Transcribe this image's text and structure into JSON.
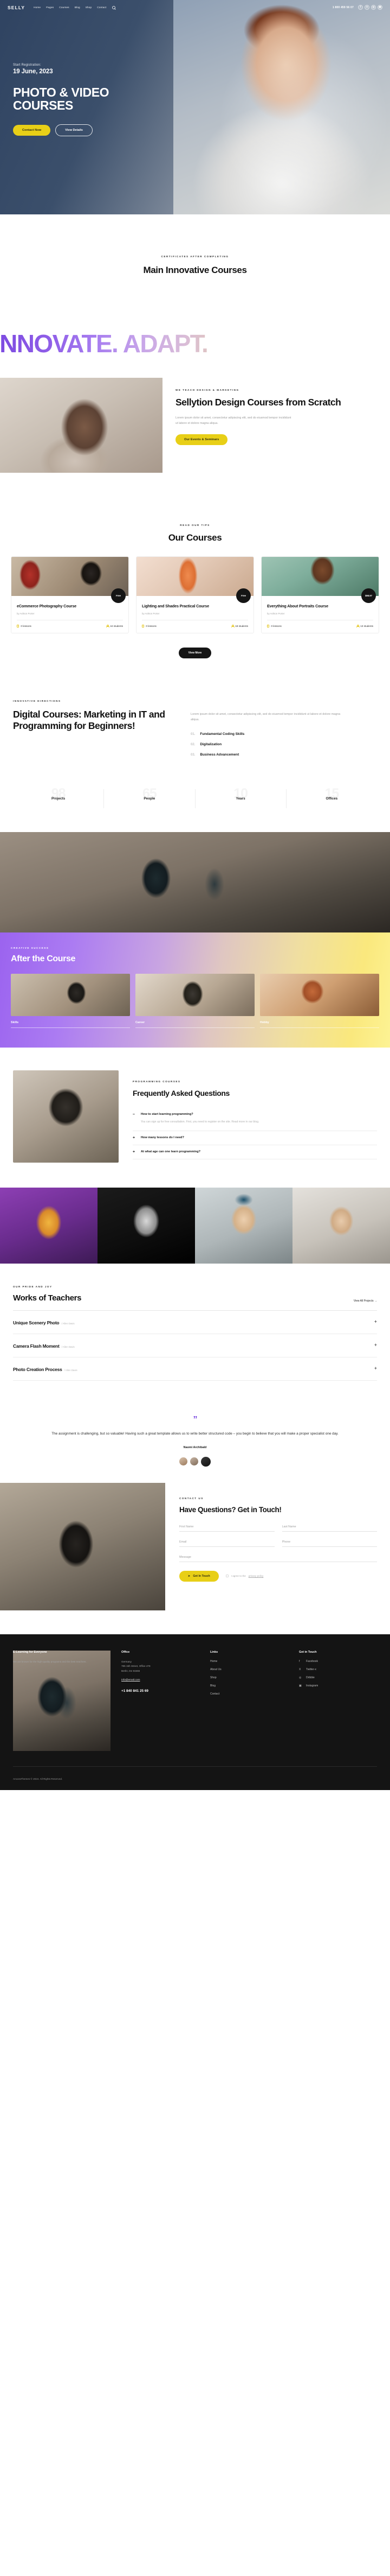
{
  "header": {
    "brand": "SELLY",
    "nav": [
      "Home",
      "Pages",
      "Courses",
      "Blog",
      "Shop",
      "Contact"
    ],
    "search_icon": "search-icon",
    "phone": "1 800 459 56 07",
    "socials": [
      {
        "name": "facebook-icon",
        "glyph": "f"
      },
      {
        "name": "twitter-x-icon",
        "glyph": "X"
      },
      {
        "name": "dribbble-icon",
        "glyph": "◎"
      },
      {
        "name": "instagram-icon",
        "glyph": "▣"
      }
    ]
  },
  "hero": {
    "kicker": "Start Registration:",
    "date": "19 June, 2023",
    "title": "PHOTO & VIDEO COURSES",
    "primary_btn": "Contact Now",
    "secondary_btn": "View Details"
  },
  "main_courses": {
    "label": "CERTIFICATES AFTER COMPLETING",
    "title": "Main Innovative Courses"
  },
  "marquee": {
    "text": "INNOVATE. ADAPT.",
    "gradient_from": "#7b49e0",
    "gradient_to": "#fbf39a"
  },
  "design_block": {
    "label": "WE TEACH DESIGN & MARKETING",
    "title": "Sellytion Design Courses from Scratch",
    "text": "Lorem ipsum dolor sit amet, consectetur adipiscing elit, sed do eiusmod tempor incididunt ut labore et dolore magna aliqua.",
    "button": "Our Events & Seminars"
  },
  "courses": {
    "label": "READ OUR TIPS",
    "title": "Our Courses",
    "more_button": "View More",
    "items": [
      {
        "price": "Free",
        "title": "eCommerce Photography Course",
        "author": "by Ashton Porter",
        "lessons": "0 lessons",
        "students": "44 students"
      },
      {
        "price": "Free",
        "title": "Lighting and Shades Practical Course",
        "author": "by Ashton Porter",
        "lessons": "0 lessons",
        "students": "18 students"
      },
      {
        "price": "$98.97",
        "title": "Everything About Portraits Course",
        "author": "by Ashton Porter",
        "lessons": "0 lessons",
        "students": "13 students"
      }
    ]
  },
  "digital": {
    "label": "INNOVATIVE DIRECTIONS",
    "title": "Digital Courses: Marketing in IT and Programming for Beginners!",
    "text": "Lorem ipsum dolor sit amet, consectetur adipiscing elit, sed do eiusmod tempor incididunt ut labore et dolore magna aliqua.",
    "list": [
      {
        "num": "01.",
        "text": "Fundamental Coding Skills"
      },
      {
        "num": "02.",
        "text": "Digitalization"
      },
      {
        "num": "03.",
        "text": "Business Advancement"
      }
    ]
  },
  "stats": [
    {
      "number": "98",
      "label": "Projects"
    },
    {
      "number": "65",
      "label": "People"
    },
    {
      "number": "10",
      "label": "Years"
    },
    {
      "number": "15",
      "label": "Offices"
    }
  ],
  "after_course": {
    "label": "CREATIVE SUCCESS",
    "title": "After the Course",
    "cards": [
      {
        "label": "Skills"
      },
      {
        "label": "Career"
      },
      {
        "label": "Hobby"
      }
    ]
  },
  "faq": {
    "label": "PROGRAMMING COURSES",
    "title": "Frequently Asked Questions",
    "items": [
      {
        "sign": "–",
        "question": "How to start learning programming?",
        "answer": "You can sign up for free consultation. First, you need to register on the site. Read more in our blog."
      },
      {
        "sign": "+",
        "question": "How many lessons do I need?",
        "answer": ""
      },
      {
        "sign": "+",
        "question": "At what age can one learn programming?",
        "answer": ""
      }
    ]
  },
  "works": {
    "label": "OUR PRIDE AND JOY",
    "title": "Works of Teachers",
    "link": "View All Projects  →",
    "rows": [
      {
        "title": "Unique Scenery Photo",
        "author": "/ Allen Davis",
        "sign": "+"
      },
      {
        "title": "Camera Flash Moment",
        "author": "/ Allen Davis",
        "sign": "+"
      },
      {
        "title": "Photo Creation Process",
        "author": "/ Allen Davis",
        "sign": "+"
      }
    ]
  },
  "testimonial": {
    "quote_mark": "”",
    "text": "The assignment is challenging, but so valuable! Having such a great template allows us to write better structured code – you begin to believe that you will make a proper specialist one day.",
    "name": "Naomi Archibald"
  },
  "contact": {
    "label": "CONTACT US",
    "title": "Have Questions? Get in Touch!",
    "fields": {
      "first_name": "First Name",
      "last_name": "Last Name",
      "email": "Email",
      "phone": "Phone",
      "message": "Message"
    },
    "submit": "Get In Touch",
    "submit_icon": "send-icon",
    "agree_prefix": "I agree to the ",
    "agree_link": "privacy policy"
  },
  "footer": {
    "about_title": "E-Learning for Everyone",
    "about_text": "We are known for the high-quality programs and the best teachers.",
    "office_title": "Office",
    "office_lines": [
      "785 15h Street, Office 478",
      "Berlin, De 81566"
    ],
    "office_country": "Germany",
    "email": "info@email.com",
    "phone": "+1 840 841 25 69",
    "links_title": "Links",
    "links": [
      "Home",
      "About Us",
      "Shop",
      "Blog",
      "Contact"
    ],
    "social_title": "Get in Touch",
    "socials": [
      {
        "icon": "f",
        "label": "Facebook"
      },
      {
        "icon": "X",
        "label": "Twitter-x"
      },
      {
        "icon": "◎",
        "label": "Dribble"
      },
      {
        "icon": "▣",
        "label": "Instagram"
      }
    ],
    "copyright": "AncoraThemes © 2024. All Rights Reserved."
  }
}
